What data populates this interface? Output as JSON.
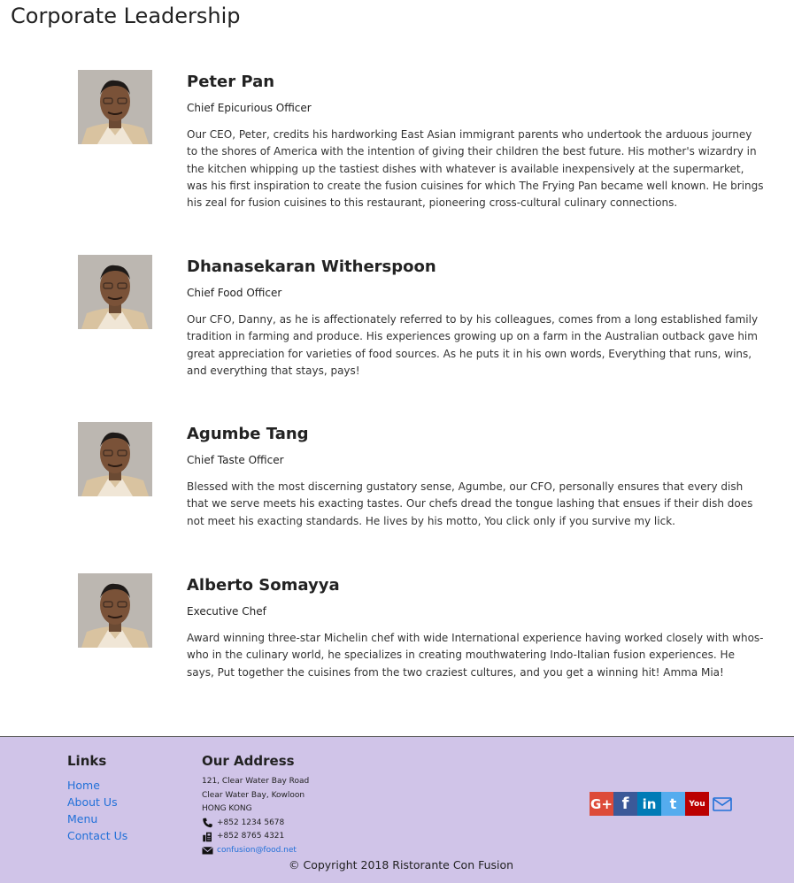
{
  "page": {
    "title": "Corporate Leadership"
  },
  "leaders": [
    {
      "name": "Peter Pan",
      "role": "Chief Epicurious Officer",
      "bio": "Our CEO, Peter, credits his hardworking East Asian immigrant parents who undertook the arduous journey to the shores of America with the intention of giving their children the best future. His mother's wizardry in the kitchen whipping up the tastiest dishes with whatever is available inexpensively at the supermarket, was his first inspiration to create the fusion cuisines for which The Frying Pan became well known. He brings his zeal for fusion cuisines to this restaurant, pioneering cross-cultural culinary connections."
    },
    {
      "name": "Dhanasekaran Witherspoon",
      "role": "Chief Food Officer",
      "bio": "Our CFO, Danny, as he is affectionately referred to by his colleagues, comes from a long established family tradition in farming and produce. His experiences growing up on a farm in the Australian outback gave him great appreciation for varieties of food sources. As he puts it in his own words, Everything that runs, wins, and everything that stays, pays!"
    },
    {
      "name": "Agumbe Tang",
      "role": "Chief Taste Officer",
      "bio": "Blessed with the most discerning gustatory sense, Agumbe, our CFO, personally ensures that every dish that we serve meets his exacting tastes. Our chefs dread the tongue lashing that ensues if their dish does not meet his exacting standards. He lives by his motto, You click only if you survive my lick."
    },
    {
      "name": "Alberto Somayya",
      "role": "Executive Chef",
      "bio": "Award winning three-star Michelin chef with wide International experience having worked closely with whos-who in the culinary world, he specializes in creating mouthwatering Indo-Italian fusion experiences. He says, Put together the cuisines from the two craziest cultures, and you get a winning hit! Amma Mia!"
    }
  ],
  "footer": {
    "links_heading": "Links",
    "links": [
      "Home",
      "About Us",
      "Menu",
      "Contact Us"
    ],
    "address_heading": "Our Address",
    "address_lines": [
      "121, Clear Water Bay Road",
      "Clear Water Bay, Kowloon",
      "HONG KONG"
    ],
    "phone": "+852 1234 5678",
    "fax": "+852 8765 4321",
    "email": "confusion@food.net",
    "social": [
      {
        "icon": "google-plus-icon",
        "glyph": "G+",
        "color": "#dd4b39"
      },
      {
        "icon": "facebook-icon",
        "glyph": "f",
        "color": "#3b5998"
      },
      {
        "icon": "linkedin-icon",
        "glyph": "in",
        "color": "#007bb6"
      },
      {
        "icon": "twitter-icon",
        "glyph": "t",
        "color": "#55acee"
      },
      {
        "icon": "youtube-icon",
        "glyph": "You",
        "color": "#bb0000"
      }
    ],
    "copyright": "© Copyright 2018 Ristorante Con Fusion",
    "background": "#d0c4e8",
    "link_color": "#2170d8"
  }
}
